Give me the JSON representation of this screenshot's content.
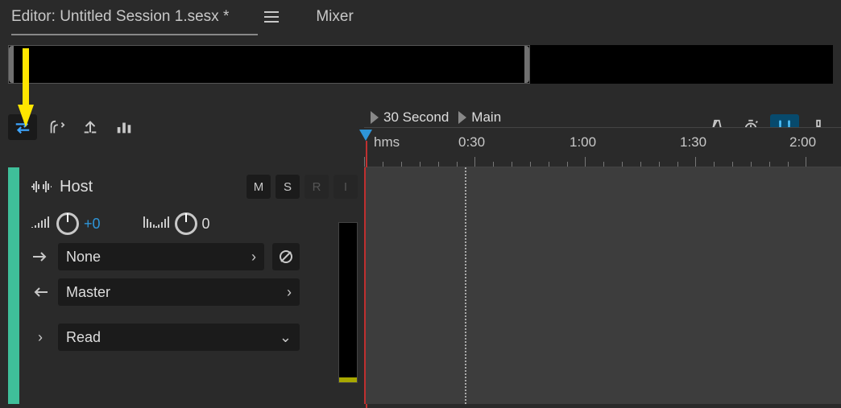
{
  "tabs": {
    "editor_label": "Editor: Untitled Session 1.sesx *",
    "mixer_label": "Mixer"
  },
  "markers": {
    "m1": "30 Second",
    "m2": "Main"
  },
  "ruler": {
    "unit": "hms",
    "labels": [
      "0:30",
      "1:00",
      "1:30",
      "2:00"
    ]
  },
  "toolbar": {
    "inouts": "in-outs",
    "fx": "fx",
    "sends": "sends",
    "eq": "eq",
    "metronome": "metronome",
    "prepost": "prepost",
    "snap": "snap",
    "tool": "tool"
  },
  "track": {
    "name": "Host",
    "msri": {
      "m": "M",
      "s": "S",
      "r": "R",
      "i": "I"
    },
    "vol_value": "+0",
    "pan_value": "0",
    "input_label": "None",
    "output_label": "Master",
    "automation_label": "Read"
  }
}
